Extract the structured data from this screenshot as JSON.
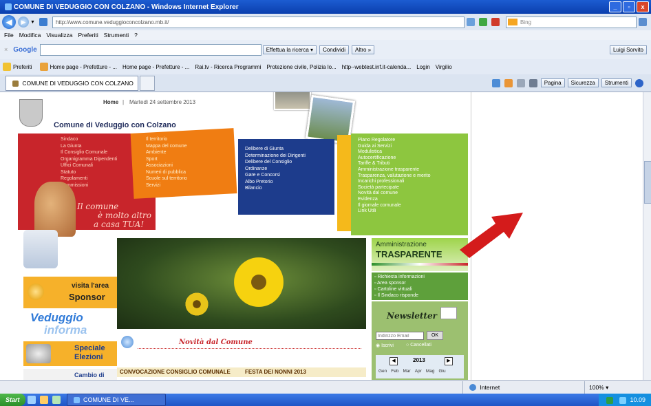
{
  "window": {
    "title": "COMUNE DI VEDUGGIO CON COLZANO - Windows Internet Explorer",
    "controls": [
      "_",
      "▫",
      "x"
    ]
  },
  "address": {
    "url": "http://www.comune.veduggioconcolzano.mb.it/",
    "search_placeholder": "Bing"
  },
  "menu": [
    "File",
    "Modifica",
    "Visualizza",
    "Preferiti",
    "Strumenti",
    "?"
  ],
  "google_toolbar": {
    "logo": "Google",
    "search_label": "Effettua la ricerca",
    "share_label": "Condividi",
    "more_label": "Altro »",
    "user_label": "Luigi Sorvito"
  },
  "favorites": {
    "label": "Preferiti",
    "items": [
      "Home page - Prefetture - ...",
      "Home page - Prefetture - ...",
      "Rai.tv - Ricerca Programmi",
      "Protezione civile, Polizia lo...",
      "http--webtest.inf.it-calenda...",
      "Login",
      "Virgilio"
    ]
  },
  "tab": {
    "title": "COMUNE DI VEDUGGIO CON COLZANO"
  },
  "commandbar": [
    "Pagina",
    "Sicurezza",
    "Strumenti"
  ],
  "page": {
    "nav_home": "Home",
    "date": "Martedì 24 settembre 2013",
    "site_title": "Comune di Veduggio con Colzano",
    "red_menu": [
      "Sindaco",
      "La Giunta",
      "Il Consiglio Comunale",
      "Organigramma Dipendenti",
      "Uffici Comunali",
      "Statuto",
      "Regolamenti",
      "Commissioni"
    ],
    "orange_menu": [
      "Il territorio",
      "Mappa del comune",
      "Ambiente",
      "Sport",
      "Associazioni",
      "Numeri di pubblica",
      "Scuole sul territorio",
      "Servizi"
    ],
    "blue_menu": [
      "Delibere di Giunta",
      "Determinazione dei Dirigenti",
      "Delibere del Consiglio",
      "Ordinanze",
      "Gare e Concorsi",
      "Albo Pretorio",
      "Bilancio"
    ],
    "green_menu": [
      "Piano Regolatore",
      "Guida ai Servizi",
      "Modulistica",
      "Autocertificazione",
      "Tariffe & Tributi",
      "Amministrazione trasparente",
      "Trasparenza, valutazione e merito",
      "Incarichi professionali",
      "Società partecipate",
      "Novità dal comune",
      "Evidenza",
      "Il giornale comunale",
      "Link Utili"
    ],
    "slogan": [
      "Il comune",
      "è molto altro",
      "a casa TUA!"
    ],
    "trasparenza_top": "Amministrazione",
    "trasparenza_bottom": "TRASPARENTE",
    "right_links": [
      "Richiesta informazioni",
      "Area sponsor",
      "Cartoline virtuali",
      "Il Sindaco risponde"
    ],
    "newsletter": "Newsletter",
    "email_placeholder": "Indirizzo Email",
    "ok_label": "OK",
    "radio_1": "Iscrivi",
    "radio_2": "Cancellati",
    "year": "2013",
    "months": [
      "Gen",
      "Feb",
      "Mar",
      "Apr",
      "Mag",
      "Giu"
    ],
    "sponsor_1": "visita l'area",
    "sponsor_2": "Sponsor",
    "veduggio": "Veduggio",
    "informa": "informa",
    "speciale_1": "Speciale",
    "speciale_2": "Elezioni",
    "cambio": "Cambio di",
    "novita": "Novità dal Comune",
    "news_1": "CONVOCAZIONE CONSIGLIO COMUNALE",
    "news_2": "FESTA DEI NONNI 2013"
  },
  "status": {
    "zone": "Internet",
    "zoom": "100%"
  },
  "taskbar": {
    "start": "Start",
    "window": "COMUNE DI VE...",
    "clock": "10.09"
  },
  "colors": {
    "red": "#c8252b",
    "orange": "#f07d12",
    "blue": "#1d3c8c",
    "green": "#8dc63f",
    "arrow": "#d41b1b"
  }
}
